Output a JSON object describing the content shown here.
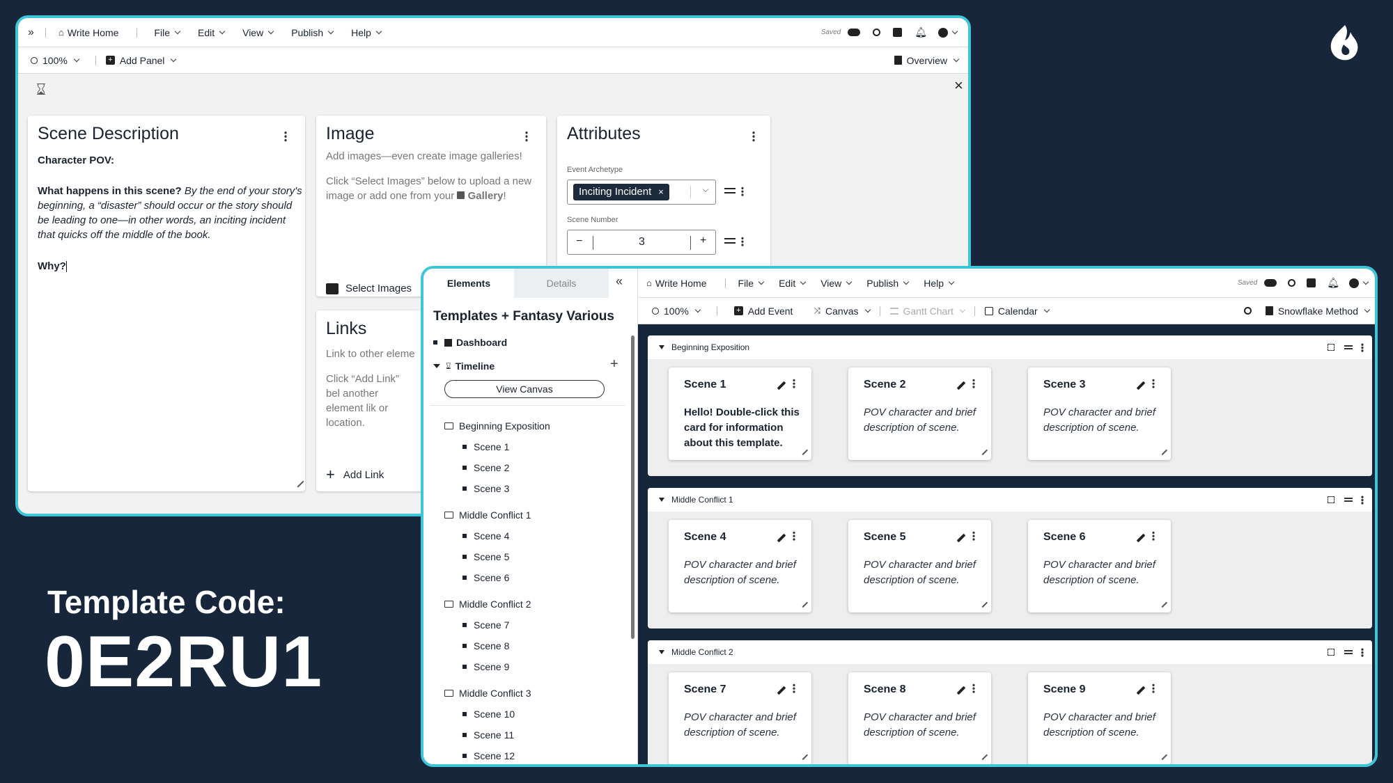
{
  "brand": {
    "logo_icon": "flame-logo-icon"
  },
  "template_code": {
    "label": "Template Code:",
    "code": "0E2RU1"
  },
  "win1": {
    "menu": {
      "home": "Write Home",
      "file": "File",
      "edit": "Edit",
      "view": "View",
      "publish": "Publish",
      "help": "Help",
      "saved": "Saved"
    },
    "toolbar": {
      "zoom": "100%",
      "add_panel": "Add Panel",
      "overview": "Overview"
    },
    "scene_description": {
      "title": "Scene Description",
      "pov_label": "Character POV:",
      "q_label": "What happens in this scene?",
      "q_text": "By the end of your story's beginning, a “disaster” should occur or the story should be leading to one—in other words, an inciting incident that quicks off the middle of the book.",
      "why": "Why?"
    },
    "image": {
      "title": "Image",
      "hint": "Add images—even create image galleries!",
      "body_pre": "Click “Select Images” below to upload a new image or add one from your",
      "gallery": "Gallery",
      "body_post": "!",
      "button": "Select Images"
    },
    "links": {
      "title": "Links",
      "hint": "Link to other eleme",
      "body": "Click “Add Link” bel another element lik or location.",
      "button": "Add Link"
    },
    "attributes": {
      "title": "Attributes",
      "archetype_label": "Event Archetype",
      "archetype_value": "Inciting Incident",
      "scene_number_label": "Scene Number",
      "scene_number_value": "3",
      "minus": "−",
      "plus": "+"
    }
  },
  "win2": {
    "sidebar": {
      "tab_elements": "Elements",
      "tab_details": "Details",
      "project_title": "Templates + Fantasy Various",
      "dashboard": "Dashboard",
      "timeline": "Timeline",
      "view_canvas": "View Canvas",
      "groups": [
        {
          "name": "Beginning Exposition",
          "scenes": [
            "Scene 1",
            "Scene 2",
            "Scene 3"
          ]
        },
        {
          "name": "Middle Conflict 1",
          "scenes": [
            "Scene 4",
            "Scene 5",
            "Scene 6"
          ]
        },
        {
          "name": "Middle Conflict 2",
          "scenes": [
            "Scene 7",
            "Scene 8",
            "Scene 9"
          ]
        },
        {
          "name": "Middle Conflict 3",
          "scenes": [
            "Scene 10",
            "Scene 11",
            "Scene 12"
          ]
        }
      ]
    },
    "menu": {
      "home": "Write Home",
      "file": "File",
      "edit": "Edit",
      "view": "View",
      "publish": "Publish",
      "help": "Help",
      "saved": "Saved"
    },
    "toolbar": {
      "zoom": "100%",
      "add_event": "Add Event",
      "canvas": "Canvas",
      "gantt": "Gantt Chart",
      "calendar": "Calendar",
      "method": "Snowflake Method"
    },
    "board": [
      {
        "name": "Beginning Exposition",
        "cards": [
          {
            "title": "Scene 1",
            "body": "Hello! Double-click this card for information about this template.",
            "bold": true
          },
          {
            "title": "Scene 2",
            "body": "POV character and brief description of scene."
          },
          {
            "title": "Scene 3",
            "body": "POV character and brief description of scene."
          }
        ]
      },
      {
        "name": "Middle Conflict 1",
        "cards": [
          {
            "title": "Scene 4",
            "body": "POV character and brief description of scene."
          },
          {
            "title": "Scene 5",
            "body": "POV character and brief description of scene."
          },
          {
            "title": "Scene 6",
            "body": "POV character and brief description of scene."
          }
        ]
      },
      {
        "name": "Middle Conflict 2",
        "cards": [
          {
            "title": "Scene 7",
            "body": "POV character and brief description of scene."
          },
          {
            "title": "Scene 8",
            "body": "POV character and brief description of scene."
          },
          {
            "title": "Scene 9",
            "body": "POV character and brief description of scene."
          }
        ]
      }
    ]
  },
  "colors": {
    "background": "#17263a",
    "frame_accent": "#3ec6d8",
    "tag": "#1d2b3c"
  }
}
